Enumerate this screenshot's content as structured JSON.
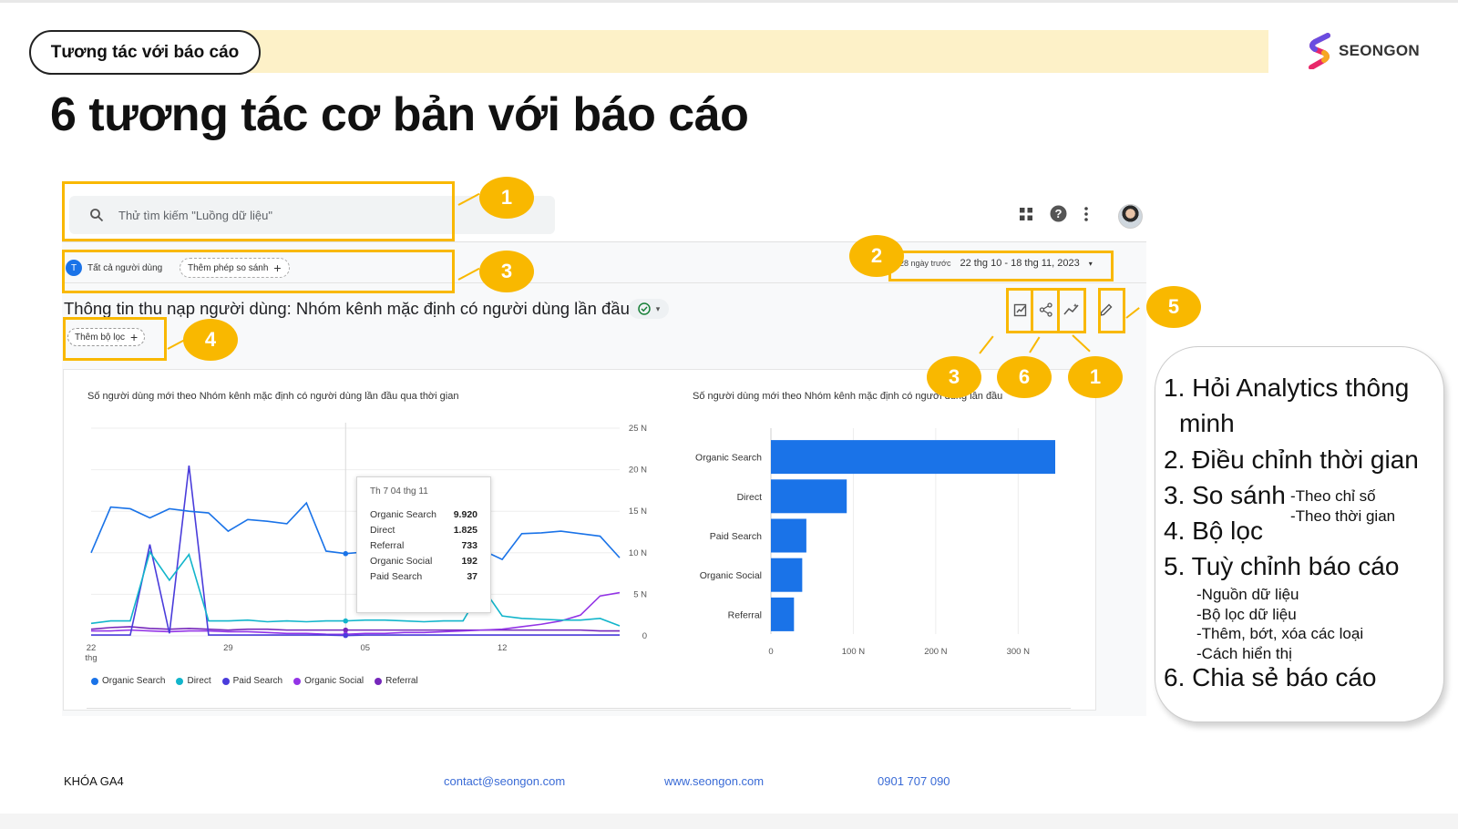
{
  "slide": {
    "section_label": "Tương tác với báo cáo",
    "title": "6 tương tác cơ bản với báo cáo",
    "logo_text": "SEONGON",
    "colors": {
      "accent_yellow": "#f9b800",
      "header_band": "#fdf1c8",
      "ga_blue": "#1a73e8",
      "link": "#3a6bd6"
    }
  },
  "ga": {
    "search_placeholder": "Thử tìm kiếm \"Luồng dữ liệu\"",
    "header_icons": [
      "apps-grid-icon",
      "help-icon",
      "more-vert-icon"
    ],
    "segment_initial": "T",
    "segment_label": "Tất cả người dùng",
    "compare_label": "Thêm phép so sánh",
    "date_prefix": "28 ngày trước",
    "date_range": "22 thg 10 - 18 thg 11, 2023",
    "report_title": "Thông tin thu nạp người dùng: Nhóm kênh mặc định có người dùng lần đầu",
    "filter_label": "Thêm bộ lọc",
    "toolbar_icons": [
      "customize-report-icon",
      "share-icon",
      "insights-icon",
      "edit-icon"
    ]
  },
  "line_chart_title": "Số người dùng mới theo Nhóm kênh mặc định có người dùng lần đầu qua thời gian",
  "bar_chart_title": "Số người dùng mới theo Nhóm kênh mặc định có người dùng lần đầu",
  "tooltip": {
    "date": "Th 7 04 thg 11",
    "rows": [
      {
        "label": "Organic Search",
        "value": "9.920"
      },
      {
        "label": "Direct",
        "value": "1.825"
      },
      {
        "label": "Referral",
        "value": "733"
      },
      {
        "label": "Organic Social",
        "value": "192"
      },
      {
        "label": "Paid Search",
        "value": "37"
      }
    ]
  },
  "chart_data": [
    {
      "type": "line",
      "title": "Số người dùng mới theo Nhóm kênh mặc định có người dùng lần đầu qua thời gian",
      "x_tick_labels": [
        "22 thg",
        "29",
        "05",
        "12"
      ],
      "y_tick_labels": [
        "25 N",
        "20 N",
        "15 N",
        "10 N",
        "5 N",
        "0"
      ],
      "ylim": [
        0,
        25
      ],
      "x": [
        "22/10",
        "23/10",
        "24/10",
        "25/10",
        "26/10",
        "27/10",
        "28/10",
        "29/10",
        "30/10",
        "31/10",
        "01/11",
        "02/11",
        "03/11",
        "04/11",
        "05/11",
        "06/11",
        "07/11",
        "08/11",
        "09/11",
        "10/11",
        "11/11",
        "12/11",
        "13/11",
        "14/11",
        "15/11",
        "16/11",
        "17/11",
        "18/11"
      ],
      "series": [
        {
          "name": "Organic Search",
          "color": "#1a73e8",
          "values": [
            10,
            15.5,
            15.3,
            14.2,
            15.3,
            15,
            14.8,
            12.6,
            14,
            13.8,
            13.5,
            16,
            10.2,
            9.9,
            10.1,
            12,
            11.2,
            10.2,
            9.5,
            10.9,
            10.3,
            9.2,
            12.3,
            12.4,
            12.6,
            12.3,
            12,
            9.4
          ]
        },
        {
          "name": "Direct",
          "color": "#12b5cb",
          "values": [
            1.5,
            1.8,
            1.8,
            10.1,
            6.7,
            9.8,
            1.8,
            1.8,
            1.9,
            1.7,
            1.8,
            1.7,
            1.8,
            1.8,
            1.9,
            1.9,
            1.8,
            1.7,
            1.8,
            1.8,
            5.8,
            2.4,
            2.1,
            2,
            1.9,
            1.9,
            2.1,
            1.2
          ]
        },
        {
          "name": "Paid Search",
          "color": "#4a3cdb",
          "values": [
            0.1,
            0.1,
            0.1,
            11,
            0.3,
            20.5,
            0.1,
            0.1,
            0.1,
            0.1,
            0.1,
            0.1,
            0.1,
            0.04,
            0.1,
            0.1,
            0.1,
            0.1,
            0.1,
            0.1,
            0.1,
            0.1,
            0.1,
            0.1,
            0.1,
            0.1,
            0.1,
            0.1
          ]
        },
        {
          "name": "Organic Social",
          "color": "#9334e6",
          "values": [
            0.6,
            0.6,
            0.7,
            0.6,
            0.5,
            0.6,
            0.6,
            0.5,
            0.5,
            0.4,
            0.3,
            0.3,
            0.2,
            0.19,
            0.3,
            0.3,
            0.4,
            0.4,
            0.5,
            0.6,
            0.7,
            0.8,
            1.1,
            1.4,
            1.8,
            2.5,
            4.8,
            5.2
          ]
        },
        {
          "name": "Referral",
          "color": "#7627bb",
          "values": [
            0.8,
            1,
            1.1,
            0.9,
            0.8,
            0.9,
            0.8,
            0.7,
            0.8,
            0.8,
            0.7,
            0.7,
            0.7,
            0.7,
            0.7,
            0.7,
            0.7,
            0.7,
            0.7,
            0.7,
            0.7,
            0.7,
            0.7,
            0.7,
            0.7,
            0.7,
            0.6,
            0.6
          ]
        }
      ],
      "legend_position": "bottom-left"
    },
    {
      "type": "bar",
      "orientation": "horizontal",
      "title": "Số người dùng mới theo Nhóm kênh mặc định có người dùng lần đầu",
      "categories": [
        "Organic Search",
        "Direct",
        "Paid Search",
        "Organic Social",
        "Referral"
      ],
      "values": [
        345,
        92,
        43,
        38,
        28
      ],
      "x_tick_labels": [
        "0",
        "100 N",
        "200 N",
        "300 N"
      ],
      "xlim": [
        0,
        345
      ],
      "color": "#1a73e8"
    }
  ],
  "callout": {
    "item1_line1": "1. Hỏi Analytics thông",
    "item1_line2": "minh",
    "item2": "2. Điều chỉnh thời gian",
    "item3": "3. So sánh",
    "item3_sub1": "-Theo chỉ số",
    "item3_sub2": "-Theo thời gian",
    "item4": "4. Bộ lọc",
    "item5": "5. Tuỳ chỉnh báo cáo",
    "item5_sub1": "-Nguồn dữ liệu",
    "item5_sub2": "-Bộ lọc dữ liệu",
    "item5_sub3": "-Thêm, bớt, xóa các loại",
    "item5_sub4": "-Cách hiển thị",
    "item6": "6. Chia sẻ báo cáo"
  },
  "badges": {
    "b1": "1",
    "b2": "2",
    "b3": "3",
    "b4": "4",
    "b5": "5",
    "b3b": "3",
    "b6": "6",
    "b1b": "1"
  },
  "footer": {
    "course": "KHÓA GA4",
    "email": "contact@seongon.com",
    "website": "www.seongon.com",
    "phone": "0901 707 090"
  }
}
